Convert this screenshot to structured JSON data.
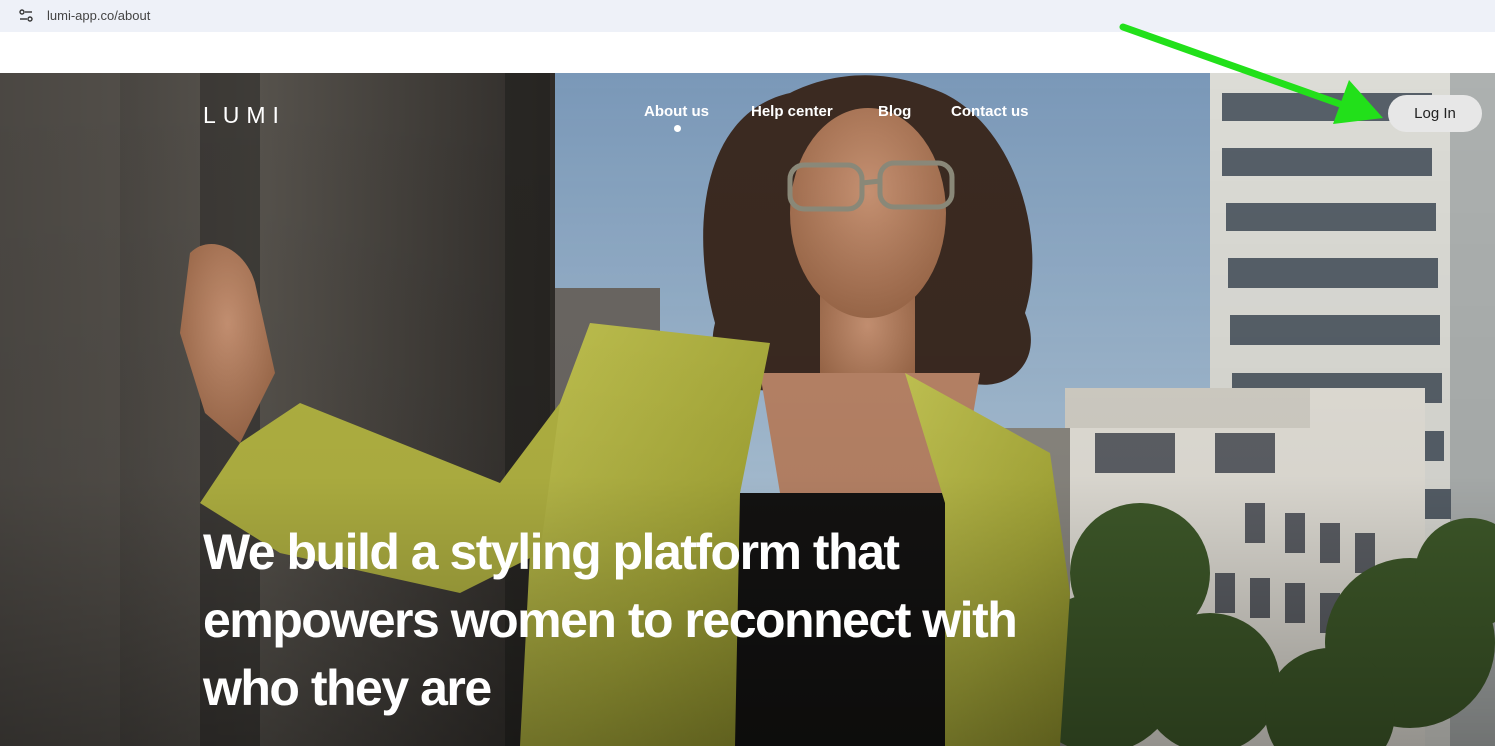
{
  "browser": {
    "url": "lumi-app.co/about",
    "site_info_icon": "tune-icon"
  },
  "site": {
    "logo": "LUMI",
    "nav": [
      {
        "label": "About us",
        "active": true
      },
      {
        "label": "Help center",
        "active": false
      },
      {
        "label": "Blog",
        "active": false
      },
      {
        "label": "Contact us",
        "active": false
      }
    ],
    "login_label": "Log In"
  },
  "hero": {
    "headline_lines": [
      "We build a styling platform that",
      "empowers women to reconnect with",
      "who they are"
    ],
    "image_description_icon": "hero-photo"
  },
  "annotation": {
    "arrow_color": "#22e01a",
    "points_to": "login-button"
  },
  "colors": {
    "jacket": "#b3b440",
    "sky": "#8fb0cc",
    "building": "#d9d9d4",
    "wall": "#4a4642"
  }
}
